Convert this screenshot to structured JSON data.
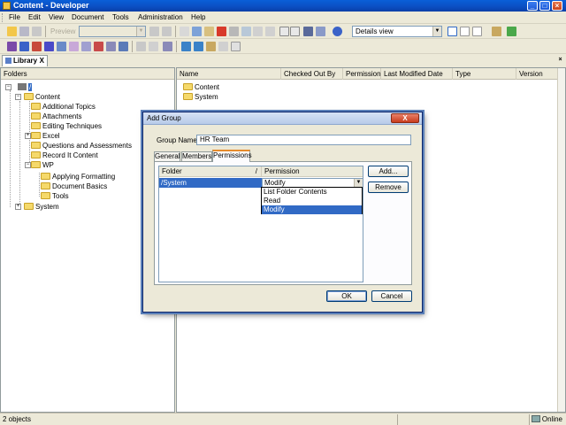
{
  "window": {
    "title": "Content - Developer"
  },
  "menu": [
    "File",
    "Edit",
    "View",
    "Document",
    "Tools",
    "Administration",
    "Help"
  ],
  "toolbar": {
    "preview_label": "Preview",
    "view_mode": "Details view"
  },
  "tabs": {
    "library": "Library",
    "close": "X"
  },
  "folders_pane": {
    "header": "Folders",
    "root": "/",
    "tree": [
      {
        "label": "Content",
        "level": 1
      },
      {
        "label": "Additional Topics",
        "level": 2
      },
      {
        "label": "Attachments",
        "level": 2
      },
      {
        "label": "Editing Techniques",
        "level": 2
      },
      {
        "label": "Excel",
        "level": 2
      },
      {
        "label": "Questions and Assessments",
        "level": 2
      },
      {
        "label": "Record It Content",
        "level": 2
      },
      {
        "label": "WP",
        "level": 2
      },
      {
        "label": "Applying Formatting",
        "level": 3
      },
      {
        "label": "Document Basics",
        "level": 3
      },
      {
        "label": "Tools",
        "level": 3
      },
      {
        "label": "System",
        "level": 1
      }
    ]
  },
  "list_pane": {
    "columns": [
      "Name",
      "Checked Out By",
      "Permission",
      "Last Modified Date",
      "Type",
      "Version"
    ],
    "items": [
      "Content",
      "System"
    ]
  },
  "dialog": {
    "title": "Add Group",
    "close": "X",
    "group_name_label": "Group Name:",
    "group_name_value": "HR Team",
    "tabs": [
      "General",
      "Members",
      "Permissions"
    ],
    "grid_columns": [
      "Folder",
      "/",
      "Permission"
    ],
    "row": {
      "folder": "/System",
      "permission": "Modify"
    },
    "permission_options": [
      "List Folder Contents",
      "Read",
      "Modify"
    ],
    "selected_option": "Modify",
    "buttons": {
      "add": "Add...",
      "remove": "Remove",
      "ok": "OK",
      "cancel": "Cancel"
    }
  },
  "status": {
    "left": "2 objects",
    "right": "Online"
  }
}
